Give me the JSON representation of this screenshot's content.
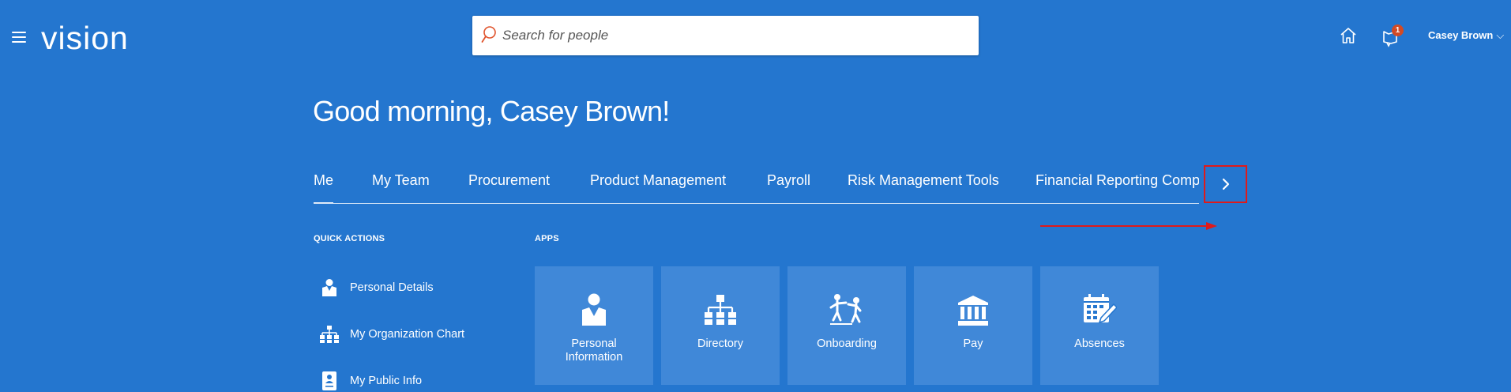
{
  "header": {
    "logo": "vision",
    "search": {
      "placeholder": "Search for people",
      "value": ""
    },
    "notifications_count": "1",
    "user_name": "Casey Brown",
    "user_chevron": "⌵"
  },
  "greeting": "Good morning, Casey Brown!",
  "tabs": [
    {
      "label": "Me",
      "active": true
    },
    {
      "label": "My Team",
      "active": false
    },
    {
      "label": "Procurement",
      "active": false
    },
    {
      "label": "Product Management",
      "active": false
    },
    {
      "label": "Payroll",
      "active": false
    },
    {
      "label": "Risk Management Tools",
      "active": false
    },
    {
      "label": "Financial Reporting Comp",
      "active": false
    }
  ],
  "quick_actions": {
    "title": "QUICK ACTIONS",
    "items": [
      {
        "label": "Personal Details",
        "icon": "person-icon"
      },
      {
        "label": "My Organization Chart",
        "icon": "org-chart-icon"
      },
      {
        "label": "My Public Info",
        "icon": "id-badge-icon"
      }
    ]
  },
  "apps": {
    "title": "APPS",
    "items": [
      {
        "label": "Personal Information",
        "icon": "person-icon"
      },
      {
        "label": "Directory",
        "icon": "org-chart-icon"
      },
      {
        "label": "Onboarding",
        "icon": "onboarding-icon"
      },
      {
        "label": "Pay",
        "icon": "bank-icon"
      },
      {
        "label": "Absences",
        "icon": "calendar-edit-icon"
      }
    ]
  },
  "colors": {
    "background": "#2476cf",
    "tile": "#4088d8",
    "badge": "#d24a24",
    "highlight": "#e01a1a",
    "search_icon": "#e0532c"
  }
}
